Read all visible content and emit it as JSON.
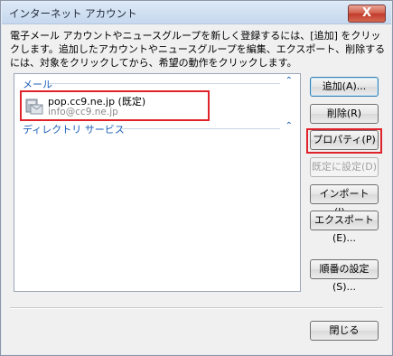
{
  "window": {
    "title": "インターネット アカウント",
    "close_glyph": "X"
  },
  "description": "電子メール アカウントやニュースグループを新しく登録するには、[追加] をクリックします。追加したアカウントやニュースグループを編集、エクスポート、削除するには、対象をクリックしてから、希望の動作をクリックします。",
  "list": {
    "groups": [
      {
        "label": "メール",
        "chevron": "⌃"
      },
      {
        "label": "ディレクトリ サービス",
        "chevron": "⌃"
      }
    ],
    "account": {
      "name": "pop.cc9.ne.jp (既定)",
      "email": "info@cc9.ne.jp",
      "icon": "mail-account-icon"
    }
  },
  "buttons": {
    "add": "追加(A)...",
    "delete": "削除(R)",
    "properties": "プロパティ(P)",
    "set_default": "既定に設定(D)",
    "import": "インポート(I)...",
    "export": "エクスポート(E)...",
    "order": "順番の設定(S)...",
    "close": "閉じる"
  },
  "colors": {
    "highlight": "#e0232b",
    "group_header": "#1b5fb8"
  }
}
